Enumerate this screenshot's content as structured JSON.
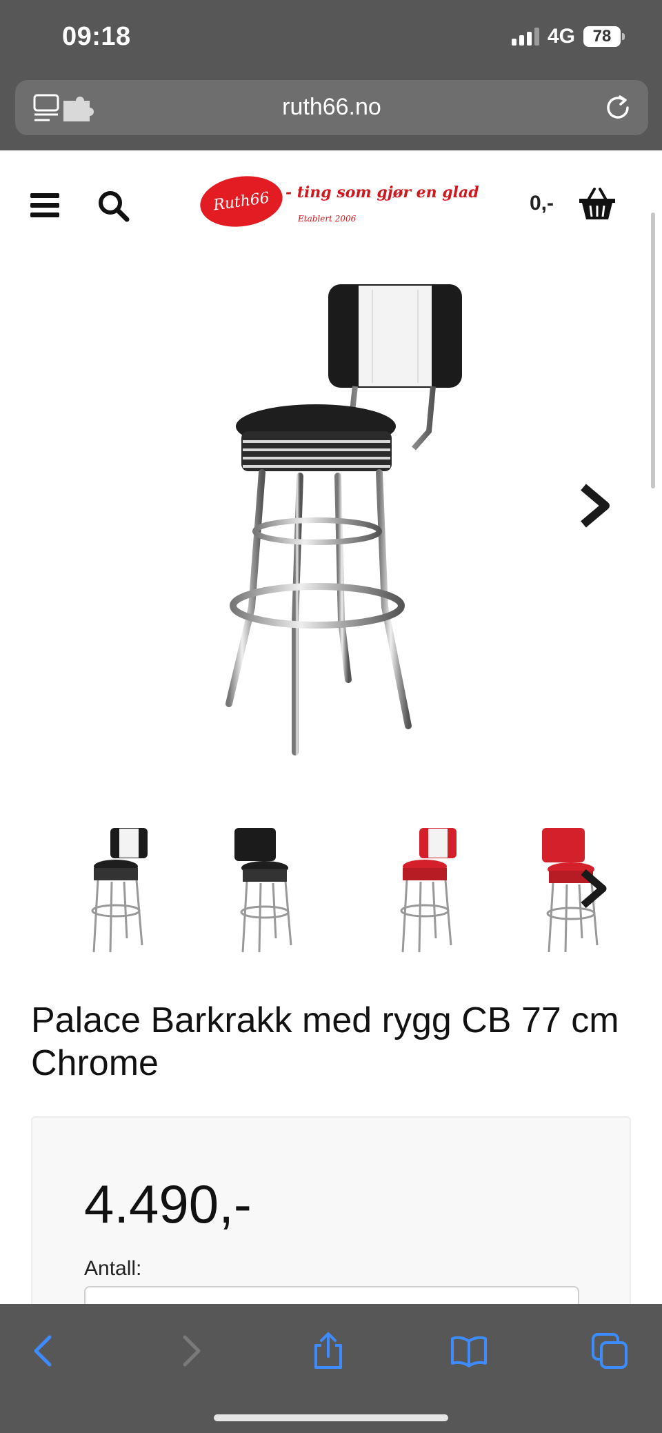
{
  "status_bar": {
    "time": "09:18",
    "network": "4G",
    "battery": "78"
  },
  "browser": {
    "url": "ruth66.no"
  },
  "header": {
    "logo_badge": "Ruth66",
    "logo_tagline": "- ting som gjør en glad",
    "logo_established": "Etablert 2006",
    "cart_total": "0,-"
  },
  "product": {
    "title": "Palace Barkrakk med rygg CB 77 cm Chrome",
    "price": "4.490,-",
    "quantity_label": "Antall:"
  },
  "thumbnails": [
    {
      "variant": "black-white",
      "back_color": "#1c1c1c",
      "seat_color": "#1c1c1c"
    },
    {
      "variant": "black",
      "back_color": "#1c1c1c",
      "seat_color": "#1c1c1c"
    },
    {
      "variant": "red-white",
      "back_color": "#d4202a",
      "seat_color": "#d4202a"
    },
    {
      "variant": "red",
      "back_color": "#d4202a",
      "seat_color": "#d4202a"
    }
  ],
  "icons": {
    "menu": "menu-icon",
    "search": "search-icon",
    "basket": "basket-icon",
    "next": "chevron-right-icon",
    "back": "back-icon",
    "forward": "forward-icon",
    "share": "share-icon",
    "bookmarks": "bookmarks-icon",
    "tabs": "tabs-icon"
  },
  "colors": {
    "brand_red": "#e31b23",
    "safari_chrome": "#575757",
    "toolbar_blue": "#3d8bff"
  }
}
